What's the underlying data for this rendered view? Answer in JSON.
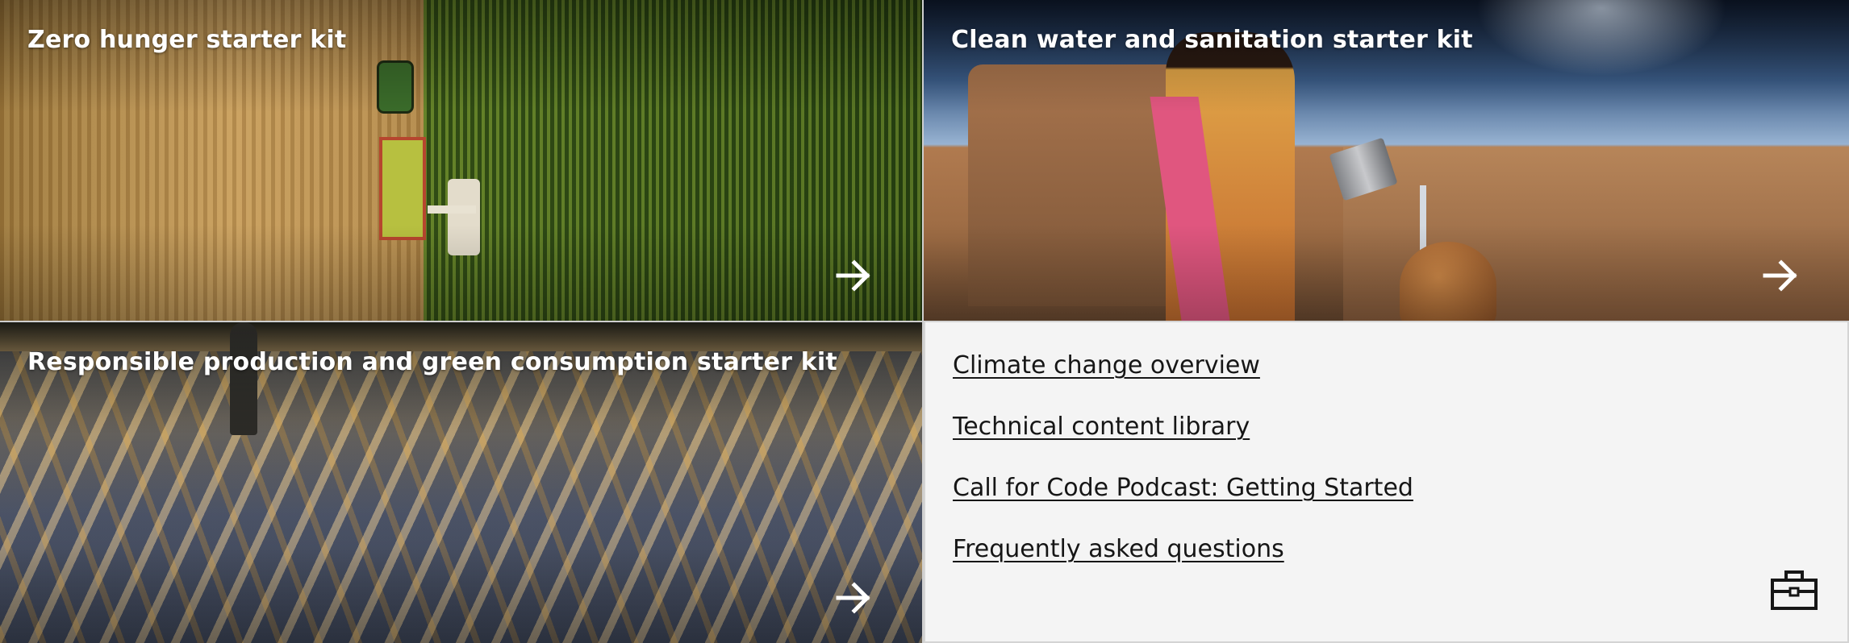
{
  "tiles": [
    {
      "title": "Zero hunger starter kit",
      "icon": "arrow-right-icon"
    },
    {
      "title": "Clean water and sanitation starter kit",
      "icon": "arrow-right-icon"
    },
    {
      "title": "Responsible production and green consumption starter kit",
      "icon": "arrow-right-icon"
    }
  ],
  "links": [
    "Climate change overview",
    "Technical content library",
    "Call for Code Podcast: Getting Started",
    "Frequently asked questions"
  ],
  "links_panel_icon": "toolkit-icon",
  "colors": {
    "tile_text": "#ffffff",
    "link_text": "#161616",
    "links_background": "#f4f4f4"
  }
}
